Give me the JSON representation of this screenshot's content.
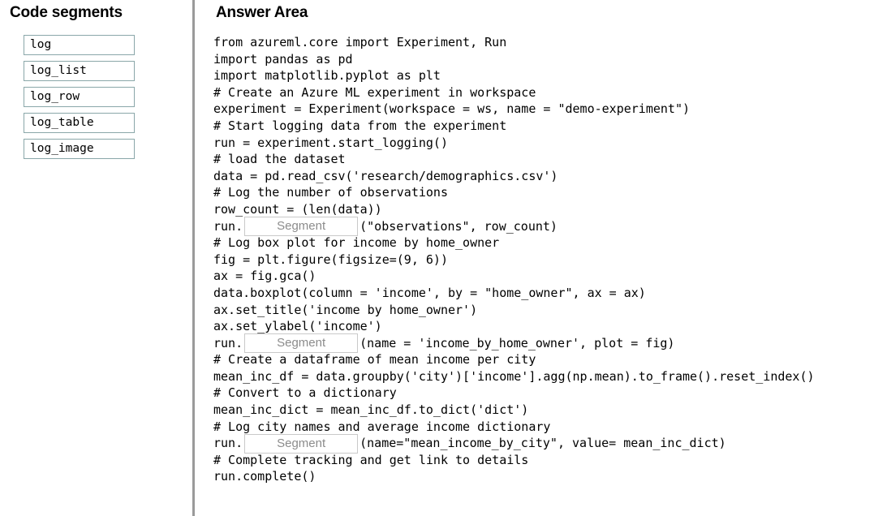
{
  "left": {
    "title": "Code segments",
    "items": [
      {
        "label": "log"
      },
      {
        "label": "log_list"
      },
      {
        "label": "log_row"
      },
      {
        "label": "log_table"
      },
      {
        "label": "log_image"
      }
    ]
  },
  "right": {
    "title": "Answer Area",
    "dropdown_placeholder": "Segment",
    "lines": [
      {
        "type": "text",
        "text": "from azureml.core import Experiment, Run"
      },
      {
        "type": "text",
        "text": "import pandas as pd"
      },
      {
        "type": "text",
        "text": "import matplotlib.pyplot as plt"
      },
      {
        "type": "text",
        "text": "# Create an Azure ML experiment in workspace"
      },
      {
        "type": "text",
        "text": "experiment = Experiment(workspace = ws, name = \"demo-experiment\")"
      },
      {
        "type": "text",
        "text": "# Start logging data from the experiment"
      },
      {
        "type": "text",
        "text": "run = experiment.start_logging()"
      },
      {
        "type": "text",
        "text": "# load the dataset"
      },
      {
        "type": "text",
        "text": "data = pd.read_csv('research/demographics.csv')"
      },
      {
        "type": "text",
        "text": "# Log the number of observations"
      },
      {
        "type": "text",
        "text": "row_count = (len(data))"
      },
      {
        "type": "dropdown",
        "before": "run.",
        "after": "(\"observations\", row_count)"
      },
      {
        "type": "text",
        "text": "# Log box plot for income by home_owner"
      },
      {
        "type": "text",
        "text": "fig = plt.figure(figsize=(9, 6))"
      },
      {
        "type": "text",
        "text": "ax = fig.gca()"
      },
      {
        "type": "text",
        "text": "data.boxplot(column = 'income', by = \"home_owner\", ax = ax)"
      },
      {
        "type": "text",
        "text": "ax.set_title('income by home_owner')"
      },
      {
        "type": "text",
        "text": "ax.set_ylabel('income')"
      },
      {
        "type": "dropdown",
        "before": "run.",
        "after": "(name = 'income_by_home_owner', plot = fig)"
      },
      {
        "type": "text",
        "text": "# Create a dataframe of mean income per city"
      },
      {
        "type": "text",
        "text": "mean_inc_df = data.groupby('city')['income'].agg(np.mean).to_frame().reset_index()"
      },
      {
        "type": "text",
        "text": "# Convert to a dictionary"
      },
      {
        "type": "text",
        "text": "mean_inc_dict = mean_inc_df.to_dict('dict')"
      },
      {
        "type": "text",
        "text": "# Log city names and average income dictionary"
      },
      {
        "type": "dropdown",
        "before": "run.",
        "after": "(name=\"mean_income_by_city\", value= mean_inc_dict)"
      },
      {
        "type": "text",
        "text": "# Complete tracking and get link to details"
      },
      {
        "type": "text",
        "text": "run.complete()"
      }
    ]
  },
  "colors": {
    "chip_border": "#8aa7a9",
    "divider": "#9a9a9a",
    "dropdown_border": "#c9c9c9",
    "dropdown_text": "#8c8c8c"
  }
}
